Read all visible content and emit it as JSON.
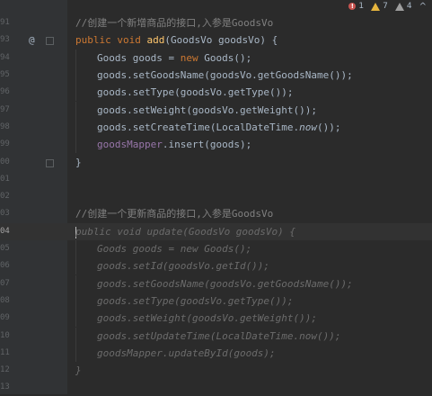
{
  "status": {
    "errors": "1",
    "warnings": "7",
    "weak_warnings": "4",
    "up_arrow": "^"
  },
  "lines": [
    {
      "num": "91",
      "text": "//创建一个新增商品的接口,入参是GoodsVo"
    },
    {
      "num": "93",
      "marker": "@"
    },
    {
      "num": "94"
    },
    {
      "num": "95"
    },
    {
      "num": "96"
    },
    {
      "num": "97"
    },
    {
      "num": "98"
    },
    {
      "num": "99"
    },
    {
      "num": "00"
    },
    {
      "num": "01"
    },
    {
      "num": "02"
    },
    {
      "num": "03",
      "text": "//创建一个更新商品的接口,入参是GoodsVo"
    },
    {
      "num": "04"
    },
    {
      "num": "05"
    },
    {
      "num": "06"
    },
    {
      "num": "07"
    },
    {
      "num": "08"
    },
    {
      "num": "09"
    },
    {
      "num": "10"
    },
    {
      "num": "11"
    },
    {
      "num": "12"
    },
    {
      "num": "13"
    }
  ],
  "code": {
    "add_sig": {
      "kw1": "public",
      "kw2": "void",
      "fn": "add",
      "rest": "(GoodsVo goodsVo) {"
    },
    "l94": {
      "a": "Goods goods = ",
      "kw": "new",
      "b": " Goods();"
    },
    "l95": "goods.setGoodsName(goodsVo.getGoodsName());",
    "l96": "goods.setType(goodsVo.getType());",
    "l97": "goods.setWeight(goodsVo.getWeight());",
    "l98": {
      "a": "goods.setCreateTime(LocalDateTime.",
      "it": "now",
      "b": "());"
    },
    "l99": {
      "field": "goodsMapper",
      "b": ".insert(goods);"
    },
    "close1": "}",
    "update_sig": "public void update(GoodsVo goodsVo) {",
    "u1": "Goods goods = new Goods();",
    "u2": "goods.setId(goodsVo.getId());",
    "u3": "goods.setGoodsName(goodsVo.getGoodsName());",
    "u4": "goods.setType(goodsVo.getType());",
    "u5": "goods.setWeight(goodsVo.getWeight());",
    "u6": "goods.setUpdateTime(LocalDateTime.now());",
    "u7": "goodsMapper.updateById(goods);",
    "close2": "}"
  }
}
